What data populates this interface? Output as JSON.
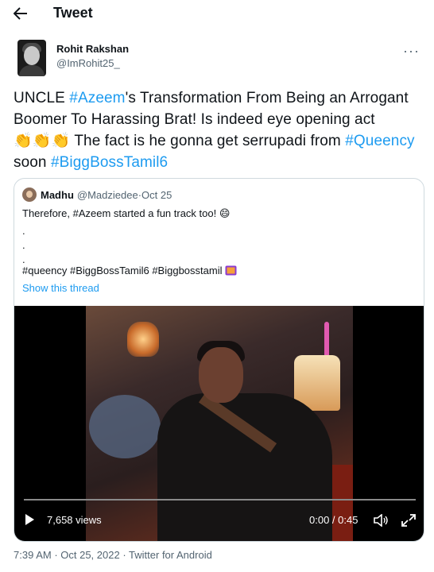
{
  "header": {
    "title": "Tweet",
    "back_icon": "arrow-left-icon"
  },
  "author": {
    "name": "Rohit Rakshan",
    "handle": "@ImRohit25_",
    "more_icon": "more-horizontal-icon"
  },
  "tweet": {
    "p1": "UNCLE ",
    "tag1": "#Azeem",
    "p2": "'s Transformation From Being an Arrogant Boomer To Harassing Brat! Is indeed eye opening act ",
    "claps": "👏👏👏",
    "p3": " The fact is he gonna get serrupadi from ",
    "tag2": "#Queency",
    "p4": " soon ",
    "tag3": "#BiggBossTamil6"
  },
  "quote": {
    "name": "Madhu",
    "handle": "@Madziedee",
    "date_sep": " · ",
    "date": "Oct 25",
    "line1": "Therefore, #Azeem started a fun track too! 😄",
    "dot1": ".",
    "dot2": ".",
    "dot3": ".",
    "tags": "#queency #BiggBossTamil6 #Biggbosstamil",
    "show_thread": "Show this thread"
  },
  "video": {
    "views": "7,658 views",
    "time": "0:00 / 0:45",
    "play_icon": "play-icon",
    "volume_icon": "volume-icon",
    "fullscreen_icon": "fullscreen-icon",
    "progress": 0
  },
  "meta": {
    "time": "7:39 AM",
    "sep": " · ",
    "date": "Oct 25, 2022",
    "source": "Twitter for Android"
  },
  "colors": {
    "link": "#1d9bf0",
    "secondary": "#536471",
    "border": "#cfd9de"
  }
}
